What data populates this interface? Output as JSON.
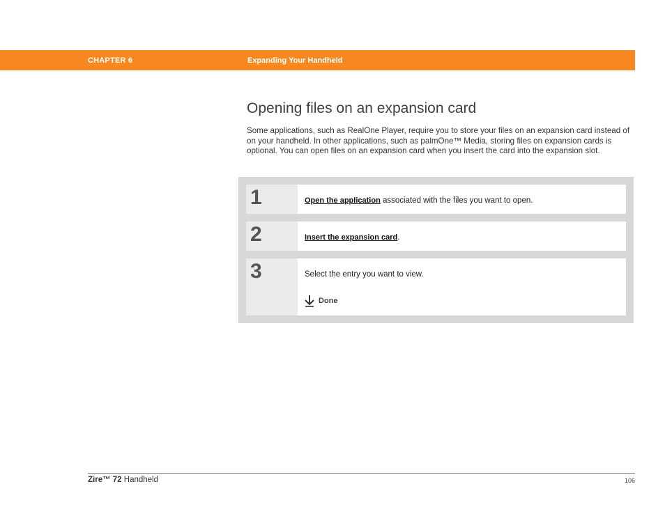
{
  "header": {
    "chapter": "CHAPTER 6",
    "title": "Expanding Your Handheld",
    "bar_color": "#f7881f"
  },
  "section": {
    "heading": "Opening files on an expansion card",
    "intro": "Some applications, such as RealOne Player, require you to store your files on an expansion card instead of on your handheld. In other applications, such as palmOne™ Media, storing files on expansion cards is optional. You can open files on an expansion card when you insert the card into the expansion slot."
  },
  "steps": [
    {
      "number": "1",
      "link": "Open the application",
      "text": " associated with the files you want to open."
    },
    {
      "number": "2",
      "link": "Insert the expansion card",
      "text": "."
    },
    {
      "number": "3",
      "text": "Select the entry you want to view."
    }
  ],
  "done": {
    "label": "Done",
    "icon": "down-arrow-icon"
  },
  "footer": {
    "product_bold": "Zire™ 72",
    "product_rest": " Handheld",
    "page_number": "106"
  }
}
